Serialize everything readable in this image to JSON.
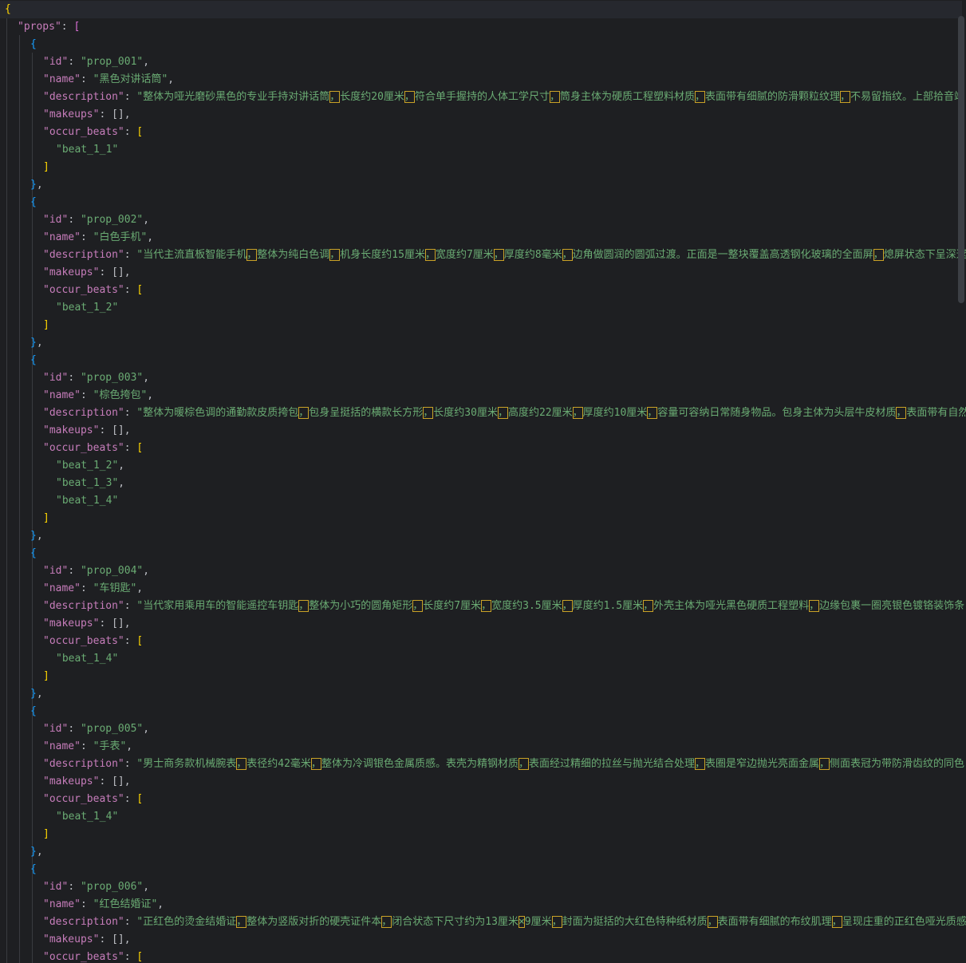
{
  "editor": {
    "language": "json",
    "indent": "  "
  },
  "root_key": "props",
  "items": [
    {
      "id": "prop_001",
      "name": "黑色对讲话筒",
      "description": "整体为哑光磨砂黑色的专业手持对讲话筒，长度约20厘米，符合单手握持的人体工学尺寸，筒身主体为硬质工程塑料材质，表面带有细腻的防滑颗粒纹理，不易留指纹。上部拾音端",
      "makeups": "[]",
      "occur_beats": [
        "beat_1_1"
      ]
    },
    {
      "id": "prop_002",
      "name": "白色手机",
      "description": "当代主流直板智能手机，整体为纯白色调，机身长度约15厘米，宽度约7厘米，厚度约8毫米，边角做圆润的圆弧过渡。正面是一整块覆盖高透钢化玻璃的全面屏，熄屏状态下呈深邃",
      "makeups": "[]",
      "occur_beats": [
        "beat_1_2"
      ]
    },
    {
      "id": "prop_003",
      "name": "棕色挎包",
      "description": "整体为暖棕色调的通勤款皮质挎包，包身呈挺括的横款长方形，长度约30厘米，高度约22厘米，厚度约10厘米，容量可容纳日常随身物品。包身主体为头层牛皮材质，表面带有自然",
      "makeups": "[]",
      "occur_beats": [
        "beat_1_2",
        "beat_1_3",
        "beat_1_4"
      ]
    },
    {
      "id": "prop_004",
      "name": "车钥匙",
      "description": "当代家用乘用车的智能遥控车钥匙，整体为小巧的圆角矩形，长度约7厘米，宽度约3.5厘米，厚度约1.5厘米，外壳主体为哑光黑色硬质工程塑料，边缘包裹一圈亮银色镀铬装饰条",
      "makeups": "[]",
      "occur_beats": [
        "beat_1_4"
      ]
    },
    {
      "id": "prop_005",
      "name": "手表",
      "description": "男士商务款机械腕表，表径约42毫米，整体为冷调银色金属质感。表壳为精钢材质，表面经过精细的拉丝与抛光结合处理，表圈是窄边抛光亮面金属，侧面表冠为带防滑齿纹的同色",
      "makeups": "[]",
      "occur_beats": [
        "beat_1_4"
      ]
    },
    {
      "id": "prop_006",
      "name": "红色结婚证",
      "description": "正红色的烫金结婚证，整体为竖版对折的硬壳证件本，闭合状态下尺寸约为13厘米×9厘米，封面为挺括的大红色特种纸材质，表面带有细腻的布纹肌理，呈现庄重的正红色哑光质感",
      "makeups": "[]",
      "occur_beats": []
    }
  ]
}
